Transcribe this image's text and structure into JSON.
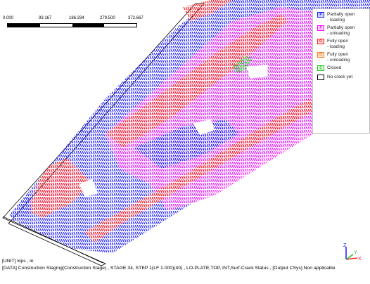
{
  "scale_bar": {
    "labels": [
      "0.000",
      "93.167",
      "186.334",
      "279.500",
      "372.667"
    ]
  },
  "legend": {
    "items": [
      {
        "code": "P",
        "label": "Partially open\n- loading",
        "color": "#1a1aff",
        "fill": "#cfd6ff"
      },
      {
        "code": "P",
        "label": "Partially open\n- unloading",
        "color": "#ff00ff",
        "fill": "#ffd9ff"
      },
      {
        "code": "O",
        "label": "Fully open\n- loading",
        "color": "#ff2020",
        "fill": "#ffd6d6"
      },
      {
        "code": "O",
        "label": "Fully open\n- unloading",
        "color": "#ff7a1a",
        "fill": "#ffe2cc"
      },
      {
        "code": "C",
        "label": "Closed",
        "color": "#20c020",
        "fill": "#d9ffd9"
      },
      {
        "code": "",
        "label": "No crack yet",
        "color": "#000000",
        "fill": "#ffffff"
      }
    ]
  },
  "status": {
    "unit_line": "[UNIT] kips , in",
    "data_line": "[DATA] Construction Staging(Construction Stage) , STAGE 34, STEP 1(LF 1.000)(40) , LO-PLATE,TOP, INT,Surf-Crack Status , [Output CSys] Non applicable"
  },
  "triad": {
    "labels": [
      "X",
      "Y",
      "Z"
    ],
    "colors": {
      "X": "#ff2020",
      "Y": "#20c020",
      "Z": "#1a1aff"
    }
  },
  "colors": {
    "blue": "#1a1aff",
    "magenta": "#ff1aff",
    "red": "#ff2020",
    "orange": "#ff7a1a",
    "green": "#33d633",
    "outline": "#000000"
  }
}
